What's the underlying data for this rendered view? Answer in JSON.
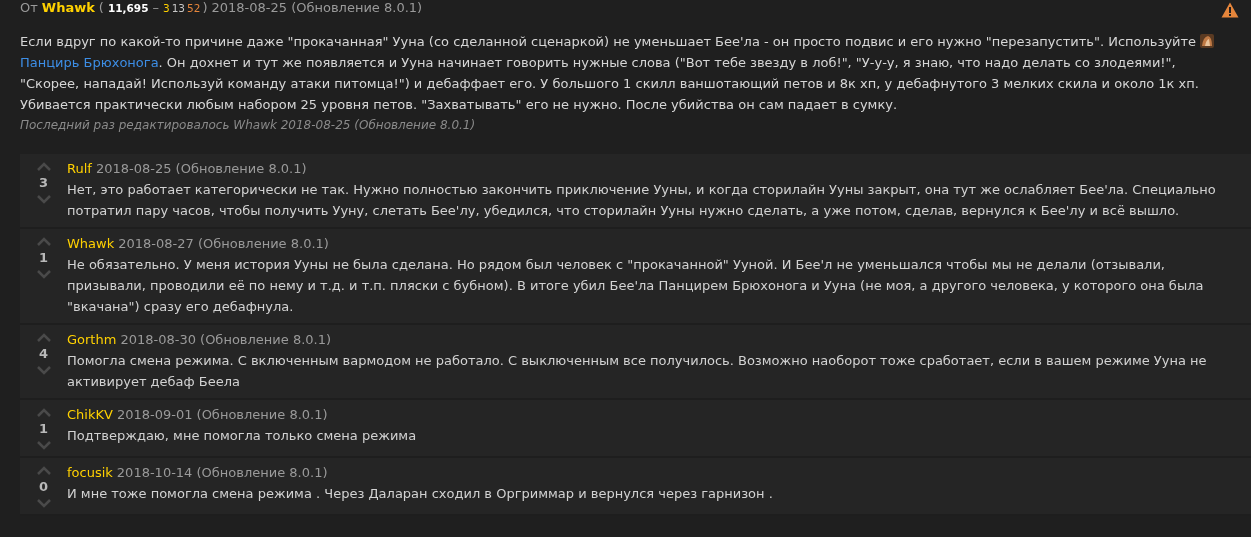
{
  "post": {
    "from_label": "От",
    "author": "Whawk",
    "open_paren": "(",
    "reputation": "11,695",
    "dash": "–",
    "achievements": [
      {
        "text": "3",
        "color": "#ffd100"
      },
      {
        "text": "13",
        "color": "#c7c7c7"
      },
      {
        "text": "52",
        "color": "#e5853b"
      }
    ],
    "close_paren": ")",
    "date": "2018-08-25 (Обновление 8.0.1)",
    "body": [
      {
        "kind": "text",
        "text": "Если вдруг по какой-то причине даже \"прокачанная\" Ууна (со сделанной сценаркой) не уменьшает Бее'ла - он просто подвис и его нужно \"перезапустить\". Используйте "
      },
      {
        "kind": "item_icon"
      },
      {
        "kind": "link",
        "text": "Панцирь Брюхонога"
      },
      {
        "kind": "text",
        "text": ". Он дохнет и тут же появляется и Ууна начинает говорить нужные слова (\"Вот тебе звезду в лоб!\", \"У-у-у, я знаю, что надо делать со злодеями!\", \"Скорее, нападай! Используй команду атаки питомца!\") и дебаффает его. У большого 1 скилл ваншотающий петов и 8к хп, у дебафнутого 3 мелких скила и около 1к хп. Убивается практически любым набором 25 уровня петов. \"Захватывать\" его не нужно. После убийства он сам падает в сумку."
      }
    ],
    "edited": "Последний раз редактировалось Whawk 2018-08-25 (Обновление 8.0.1)"
  },
  "replies": [
    {
      "score": "3",
      "author": "Rulf",
      "date": "2018-08-25 (Обновление 8.0.1)",
      "text": "Нет, это работает категорически не так. Нужно полностью закончить приключение Ууны, и когда сторилайн Ууны закрыт, она тут же ослабляет Бее'ла. Специально потратил пару часов, чтобы получить Ууну, слетать Бее'лу, убедился, что сторилайн Ууны нужно сделать, а уже потом, сделав, вернулся к Бее'лу и всё вышло."
    },
    {
      "score": "1",
      "author": "Whawk",
      "date": "2018-08-27 (Обновление 8.0.1)",
      "text": "Не обязательно. У меня история Ууны не была сделана. Но рядом был человек с \"прокачанной\" Ууной. И Бее'л не уменьшался чтобы мы не делали (отзывали, призывали, проводили её по нему и т.д. и т.п. пляски с бубном). В итоге убил Бее'ла Панцирем Брюхонога и Ууна (не моя, а другого человека, у которого она была \"вкачана\") сразу его дебафнула."
    },
    {
      "score": "4",
      "author": "Gorthm",
      "date": "2018-08-30 (Обновление 8.0.1)",
      "text": "Помогла смена режима. С включенным вармодом не работало. С выключенным все получилось. Возможно наоборот тоже сработает, если в вашем режиме Ууна не активирует дебаф Беела"
    },
    {
      "score": "1",
      "author": "ChikKV",
      "date": "2018-09-01 (Обновление 8.0.1)",
      "text": "Подтверждаю, мне помогла только смена режима"
    },
    {
      "score": "0",
      "author": "focusik",
      "date": "2018-10-14 (Обновление 8.0.1)",
      "text": "И мне тоже помогла смена режима . Через Даларан сходил в Оргриммар и вернулся через гарнизон ."
    }
  ]
}
